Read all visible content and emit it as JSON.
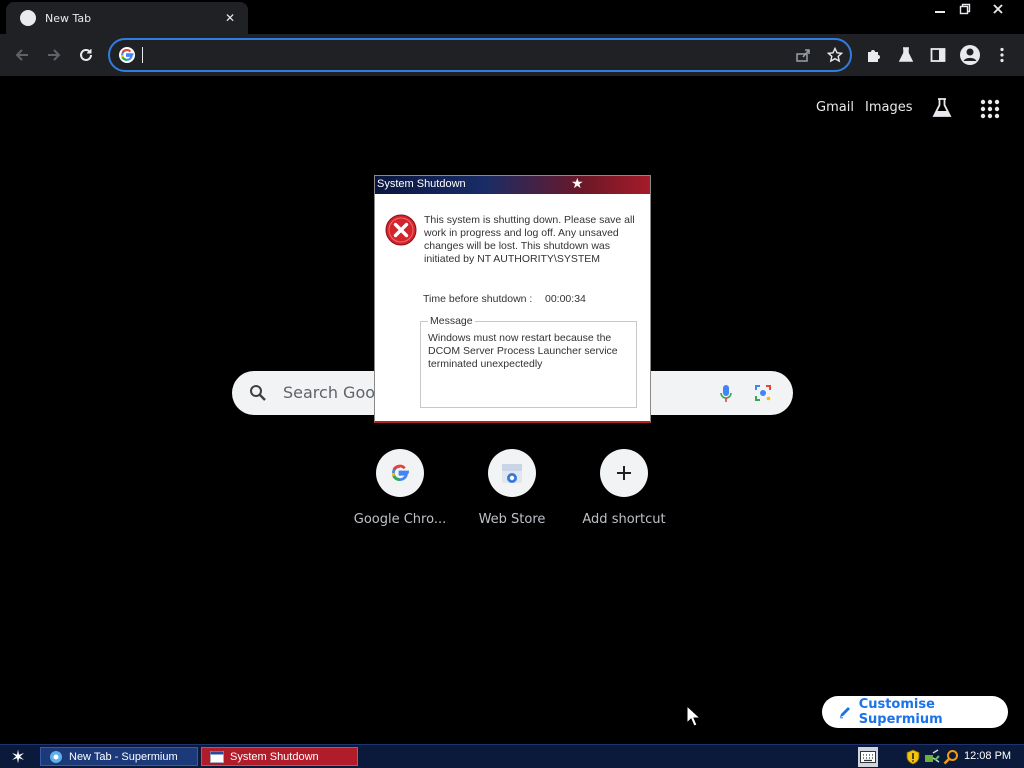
{
  "browser": {
    "tab": {
      "title": "New Tab"
    },
    "omnibox": {
      "value": "",
      "placeholder": ""
    }
  },
  "page": {
    "links": {
      "gmail": "Gmail",
      "images": "Images"
    },
    "search": {
      "placeholder": "Search Googl"
    },
    "shortcuts": [
      {
        "label": "Google Chro..."
      },
      {
        "label": "Web Store"
      },
      {
        "label": "Add shortcut"
      }
    ],
    "customise_label": "Customise Supermium"
  },
  "dialog": {
    "title": "System Shutdown",
    "body": "This system is shutting down. Please save all work in progress and log off. Any unsaved changes will be lost. This shutdown was initiated by NT AUTHORITY\\SYSTEM",
    "time_label": "Time before shutdown :",
    "time_value": "00:00:34",
    "message_label": "Message",
    "message": "Windows must now restart because the DCOM Server Process Launcher service terminated unexpectedly"
  },
  "taskbar": {
    "tasks": [
      {
        "label": "New Tab - Supermium"
      },
      {
        "label": "System Shutdown"
      }
    ],
    "clock": "12:08 PM"
  },
  "colors": {
    "accent_blue": "#2f7de1",
    "link_blue": "#1a73e8",
    "dialog_red": "#b22222",
    "taskbar": "#0b1a3a"
  }
}
